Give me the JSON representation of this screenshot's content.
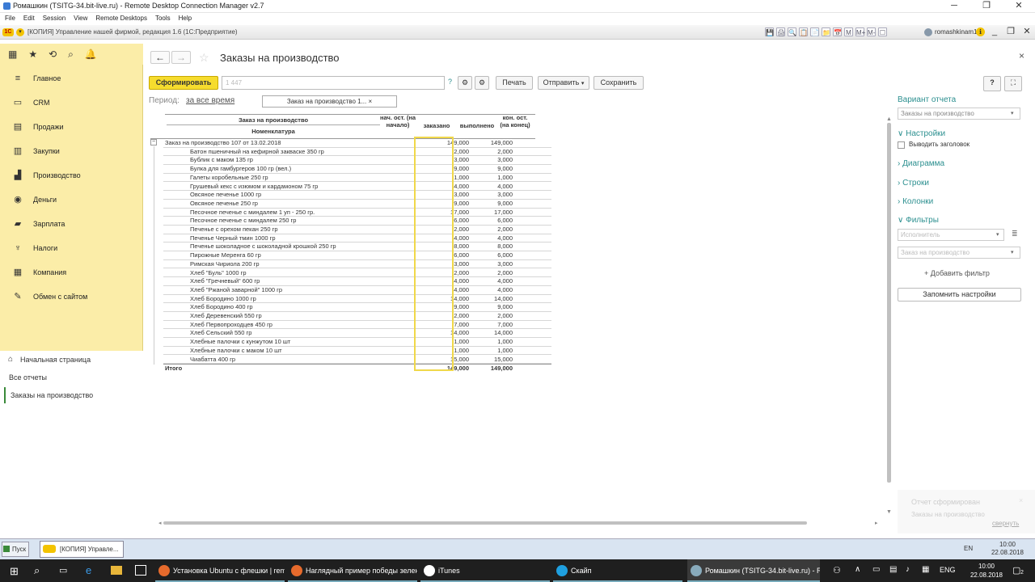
{
  "window": {
    "title": "Ромашкин (TSITG-34.bit-live.ru) - Remote Desktop Connection Manager v2.7",
    "controls": [
      "─",
      "❐",
      "✕"
    ]
  },
  "menubar": [
    "File",
    "Edit",
    "Session",
    "View",
    "Remote Desktops",
    "Tools",
    "Help"
  ],
  "app_header": {
    "logo": "1С",
    "title": "[КОПИЯ] Управление нашей фирмой, редакция 1.6  (1С:Предприятие)",
    "user": "romashkinam1",
    "icons": [
      "💾",
      "🖨",
      "🔍",
      "📋",
      "📄",
      "📁",
      "📅",
      "M",
      "M+",
      "M-",
      "☐",
      "ℹ"
    ],
    "controls": [
      "_",
      "❐",
      "✕"
    ]
  },
  "sidebar": {
    "top_icons": [
      "apps-icon",
      "star-icon",
      "history-icon",
      "search-icon",
      "bell-icon"
    ],
    "top_glyphs": [
      "▦",
      "★",
      "⟲",
      "⌕",
      "🔔"
    ],
    "sections": [
      {
        "label": "Главное",
        "icon": "≡"
      },
      {
        "label": "CRM",
        "icon": "▭"
      },
      {
        "label": "Продажи",
        "icon": "▤"
      },
      {
        "label": "Закупки",
        "icon": "▥"
      },
      {
        "label": "Производство",
        "icon": "▟"
      },
      {
        "label": "Деньги",
        "icon": "◉"
      },
      {
        "label": "Зарплата",
        "icon": "▰"
      },
      {
        "label": "Налоги",
        "icon": "♆"
      },
      {
        "label": "Компания",
        "icon": "▦"
      },
      {
        "label": "Обмен с сайтом",
        "icon": "✎"
      }
    ],
    "nav": [
      "Начальная страница",
      "Все отчеты",
      "Заказы на производство"
    ]
  },
  "main": {
    "back": "←",
    "forward": "→",
    "title": "Заказы на производство",
    "close": "×",
    "toolbar": {
      "generate": "Сформировать",
      "search_value": "1 447",
      "help": "?",
      "print": "Печать",
      "send": "Отправить",
      "save": "Сохранить",
      "help_btn": "?",
      "expand": "⛶"
    },
    "period_label": "Период:",
    "period_value": "за все время",
    "variant_field": "Заказ на производство 1... ×",
    "table": {
      "headers": {
        "order": "Заказ на производство",
        "item": "Номенклатура",
        "start": "нач. ост. (на начало)",
        "ordered": "заказано",
        "done": "выполнено",
        "end": "кон. ост. (на конец)"
      },
      "group": {
        "name": "Заказ на производство 107 от 13.02.2018",
        "ordered": "149,000",
        "done": "149,000"
      },
      "rows": [
        {
          "name": "Батон пшеничный на кефирной закваске 350 гр",
          "ordered": "2,000",
          "done": "2,000"
        },
        {
          "name": "Бублик с маком 135 гр",
          "ordered": "3,000",
          "done": "3,000"
        },
        {
          "name": "Булка для гамбургеров 100 гр (вел.)",
          "ordered": "9,000",
          "done": "9,000"
        },
        {
          "name": "Галеты коробельные 250 гр",
          "ordered": "1,000",
          "done": "1,000"
        },
        {
          "name": "Грушевый кекс с изюмом и кардамоном 75 гр",
          "ordered": "4,000",
          "done": "4,000"
        },
        {
          "name": "Овсяное печенье 1000 гр",
          "ordered": "3,000",
          "done": "3,000"
        },
        {
          "name": "Овсяное печенье 250 гр",
          "ordered": "9,000",
          "done": "9,000"
        },
        {
          "name": "Песочное печенье с миндалем 1 уп - 250 гр.",
          "ordered": "17,000",
          "done": "17,000"
        },
        {
          "name": "Песочное печенье с миндалем 250 гр",
          "ordered": "6,000",
          "done": "6,000"
        },
        {
          "name": "Печенье с орехом пекан 250 гр",
          "ordered": "2,000",
          "done": "2,000"
        },
        {
          "name": "Печенье Черный тмин 1000 гр",
          "ordered": "4,000",
          "done": "4,000"
        },
        {
          "name": "Печенье шоколадное с шоколадной крошкой 250 гр",
          "ordered": "8,000",
          "done": "8,000"
        },
        {
          "name": "Пирожные Меренга 60 гр",
          "ordered": "6,000",
          "done": "6,000"
        },
        {
          "name": "Римская Чириола 200 гр",
          "ordered": "3,000",
          "done": "3,000"
        },
        {
          "name": "Хлеб \"Буль\" 1000 гр",
          "ordered": "2,000",
          "done": "2,000"
        },
        {
          "name": "Хлеб \"Гречневый\" 600 гр",
          "ordered": "4,000",
          "done": "4,000"
        },
        {
          "name": "Хлеб \"Ржаной заварной\" 1000 гр",
          "ordered": "4,000",
          "done": "4,000"
        },
        {
          "name": "Хлеб Бородино 1000 гр",
          "ordered": "14,000",
          "done": "14,000"
        },
        {
          "name": "Хлеб Бородино 400 гр",
          "ordered": "9,000",
          "done": "9,000"
        },
        {
          "name": "Хлеб Деревенский 550 гр",
          "ordered": "2,000",
          "done": "2,000"
        },
        {
          "name": "Хлеб Первопроходцев 450 гр",
          "ordered": "7,000",
          "done": "7,000"
        },
        {
          "name": "Хлеб Сельский 550 гр",
          "ordered": "14,000",
          "done": "14,000"
        },
        {
          "name": "Хлебные палочки с кунжутом 10 шт",
          "ordered": "1,000",
          "done": "1,000"
        },
        {
          "name": "Хлебные палочки с маком 10 шт",
          "ordered": "1,000",
          "done": "1,000"
        },
        {
          "name": "Чиабатта 400 гр",
          "ordered": "15,000",
          "done": "15,000"
        }
      ],
      "total": {
        "name": "Итого",
        "ordered": "149,000",
        "done": "149,000"
      }
    }
  },
  "right_panel": {
    "variant_title": "Вариант отчета",
    "variant_value": "Заказы на производство",
    "settings": "Настройки",
    "show_header": "Выводить заголовок",
    "diagram": "Диаграмма",
    "rows": "Строки",
    "columns": "Колонки",
    "filters": "Фильтры",
    "filter1": "Исполнитель",
    "filter2": "Заказ на производство",
    "add_filter": "+ Добавить фильтр",
    "remember": "Запомнить настройки"
  },
  "notification": {
    "title": "Отчет сформирован",
    "text": "Заказы на производство",
    "collapse": "свернуть"
  },
  "rd_taskbar": {
    "start": "Пуск",
    "task": "[КОПИЯ] Управле...",
    "lang": "EN",
    "time": "10:00",
    "date": "22.08.2018"
  },
  "win_taskbar": {
    "tasks": [
      "Установка Ubuntu с флешки | rem...",
      "Наглядный пример победы зелен...",
      "iTunes",
      "Скайп",
      "Ромашкин (TSITG-34.bit-live.ru) - R..."
    ],
    "lang": "ENG",
    "time": "10:00",
    "date": "22.08.2018",
    "notif": "2"
  },
  "colors": {
    "sidebar": "#fbeda8",
    "accent": "#f6dc2e",
    "link": "#2b8f8f"
  }
}
